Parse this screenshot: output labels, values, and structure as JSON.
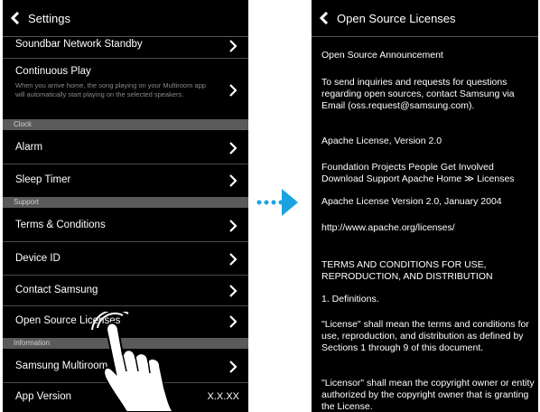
{
  "left_screen": {
    "title": "Settings",
    "items": [
      {
        "label": "Soundbar Network Standby"
      },
      {
        "label": "Continuous Play",
        "description": "When you arrive home, the song playing on your Multiroom app will automatically start playing on the selected speakers."
      }
    ],
    "sections": {
      "clock": "Clock",
      "support": "Support",
      "information": "Information"
    },
    "clock_items": [
      "Alarm",
      "Sleep Timer"
    ],
    "support_items": [
      "Terms & Conditions",
      "Device ID",
      "Contact Samsung",
      "Open Source Licenses"
    ],
    "info_items": [
      {
        "label": "Samsung Multiroom"
      },
      {
        "label": "App Version",
        "value": "X.X.XX"
      }
    ]
  },
  "right_screen": {
    "title": "Open Source Licenses",
    "paragraphs": [
      "Open Source Announcement",
      "To send inquiries and requests for questions regarding open sources, contact Samsung via Email (oss.request@samsung.com).",
      "Apache License, Version 2.0",
      "Foundation Projects People Get Involved Download Support Apache Home ≫ Licenses",
      "Apache License Version 2.0, January 2004",
      "http://www.apache.org/licenses/",
      "TERMS AND CONDITIONS FOR USE, REPRODUCTION, AND DISTRIBUTION",
      "1. Definitions.",
      "\"License\" shall mean the terms and conditions for use, reproduction, and distribution as defined by Sections 1 through 9 of this document.",
      "\"Licensor\" shall mean the copyright owner or entity authorized by the copyright owner that is granting the License."
    ]
  },
  "colors": {
    "screen_bg": "#000000",
    "section_bg": "#5a5a5a",
    "arrow": "#1aa3e0"
  }
}
